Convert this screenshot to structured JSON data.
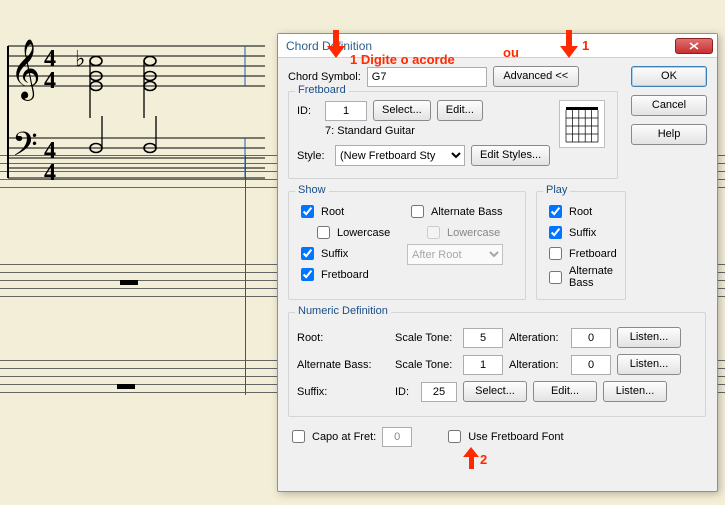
{
  "dialog": {
    "title": "Chord Definition",
    "chord_symbol_label": "Chord Symbol:",
    "chord_symbol_value": "G7",
    "advanced_label": "Advanced <<",
    "ok_label": "OK",
    "cancel_label": "Cancel",
    "help_label": "Help",
    "fretboard": {
      "legend": "Fretboard",
      "id_label": "ID:",
      "id_value": "1",
      "select_label": "Select...",
      "edit_label": "Edit...",
      "instrument_text": "7: Standard Guitar",
      "style_label": "Style:",
      "style_value": "(New Fretboard Sty",
      "edit_styles_label": "Edit Styles..."
    },
    "show": {
      "legend": "Show",
      "root": "Root",
      "lowercase": "Lowercase",
      "suffix": "Suffix",
      "fretboard": "Fretboard",
      "alt_bass": "Alternate Bass",
      "lowercase2": "Lowercase",
      "after_root": "After Root",
      "root_checked": true,
      "lowercase_checked": false,
      "suffix_checked": true,
      "fretboard_checked": true,
      "alt_bass_checked": false
    },
    "play": {
      "legend": "Play",
      "root": "Root",
      "suffix": "Suffix",
      "fretboard": "Fretboard",
      "alt_bass": "Alternate Bass",
      "root_checked": true,
      "suffix_checked": true,
      "fretboard_checked": false,
      "alt_bass_checked": false
    },
    "numeric": {
      "legend": "Numeric Definition",
      "root_label": "Root:",
      "scale_tone_label": "Scale Tone:",
      "alteration_label": "Alteration:",
      "alt_bass_label": "Alternate Bass:",
      "suffix_label": "Suffix:",
      "id_label": "ID:",
      "root_scale": "5",
      "root_alt": "0",
      "ab_scale": "1",
      "ab_alt": "0",
      "suffix_id": "25",
      "listen_label": "Listen...",
      "select_label": "Select...",
      "edit_label": "Edit..."
    },
    "capo_label": "Capo at Fret:",
    "capo_value": "0",
    "use_fret_font_label": "Use Fretboard Font"
  },
  "annotations": {
    "a1_text": "1 Digite o acorde",
    "ou_text": "ou",
    "a1b_text": "1",
    "a2_text": "2"
  },
  "score": {
    "time_top": "4",
    "time_bottom": "4"
  }
}
